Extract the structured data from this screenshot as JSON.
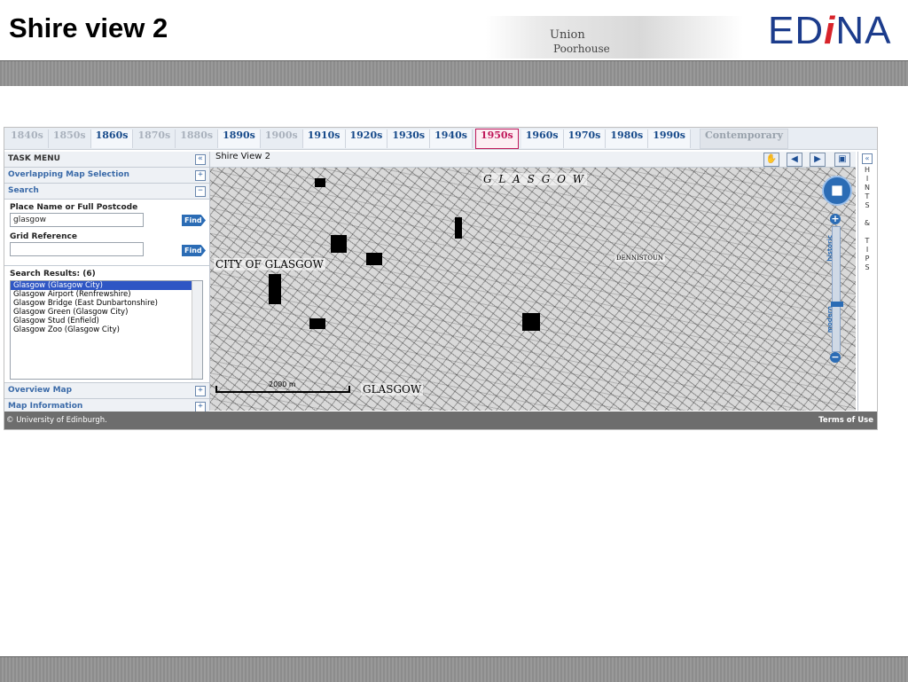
{
  "slide": {
    "title": "Shire view 2",
    "logo": {
      "pre": "ED",
      "i": "i",
      "post": "NA"
    },
    "header_map": {
      "line1": "Union",
      "line2": "Poorhouse"
    }
  },
  "decades": [
    "1840s",
    "1850s",
    "1860s",
    "1870s",
    "1880s",
    "1890s",
    "1900s",
    "1910s",
    "1920s",
    "1930s",
    "1940s",
    "1950s",
    "1960s",
    "1970s",
    "1980s",
    "1990s",
    "Contemporary"
  ],
  "task_menu": {
    "title": "TASK MENU",
    "overlapping": "Overlapping Map Selection",
    "search": "Search",
    "place_label": "Place Name or Full Postcode",
    "place_value": "glasgow",
    "find_label": "Find",
    "grid_label": "Grid Reference",
    "grid_value": "",
    "results_label": "Search Results: (6)",
    "results": [
      "Glasgow (Glasgow City)",
      "Glasgow Airport (Renfrewshire)",
      "Glasgow Bridge (East Dunbartonshire)",
      "Glasgow Green (Glasgow City)",
      "Glasgow Stud (Enfield)",
      "Glasgow Zoo (Glasgow City)"
    ],
    "overview": "Overview Map",
    "map_info": "Map Information"
  },
  "map": {
    "title": "Shire View 2",
    "labels": {
      "glasgow_top": "G L A S G O W",
      "city": "CITY OF GLASGOW",
      "glasgow_bottom": "GLASGOW",
      "dennistoun": "DENNISTOUN",
      "scale": "2000 m"
    },
    "zoom": {
      "historic": "historic",
      "modern": "modern"
    }
  },
  "hints": {
    "text": "HINTS & TIPS"
  },
  "footer": {
    "copyright": "© University of Edinburgh.",
    "terms": "Terms of Use"
  }
}
